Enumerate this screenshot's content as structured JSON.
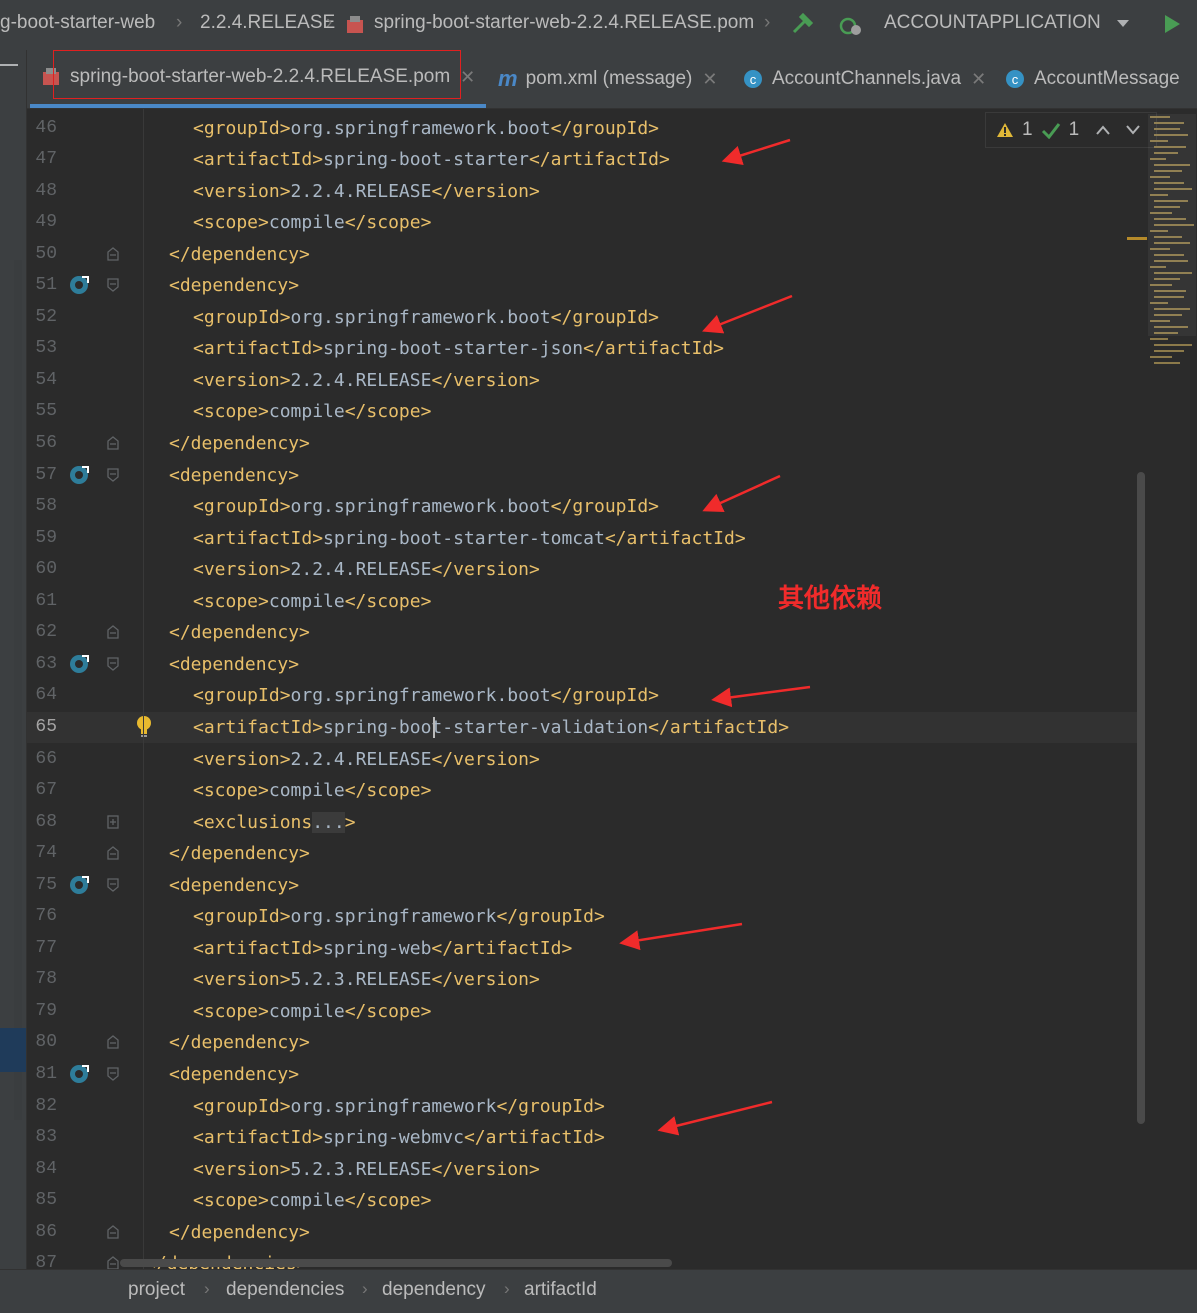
{
  "breadcrumb_nav": {
    "items": [
      "g-boot-starter-web",
      "2.2.4.RELEASE",
      "spring-boot-starter-web-2.2.4.RELEASE.pom"
    ],
    "run_config": "ACCOUNTAPPLICATION"
  },
  "tabs": [
    {
      "label": "spring-boot-starter-web-2.2.4.RELEASE.pom",
      "active": true
    },
    {
      "label": "pom.xml (message)",
      "active": false
    },
    {
      "label": "AccountChannels.java",
      "active": false
    },
    {
      "label": "AccountMessage",
      "active": false
    }
  ],
  "inspection": {
    "warnings": "1",
    "ok": "1"
  },
  "annotation": "其他依赖",
  "code_lines": [
    {
      "n": "46",
      "text": "    <groupId>org.springframework.boot</groupId>"
    },
    {
      "n": "47",
      "text": "    <artifactId>spring-boot-starter</artifactId>"
    },
    {
      "n": "48",
      "text": "    <version>2.2.4.RELEASE</version>"
    },
    {
      "n": "49",
      "text": "    <scope>compile</scope>"
    },
    {
      "n": "50",
      "text": "  </dependency>"
    },
    {
      "n": "51",
      "text": "  <dependency>"
    },
    {
      "n": "52",
      "text": "    <groupId>org.springframework.boot</groupId>"
    },
    {
      "n": "53",
      "text": "    <artifactId>spring-boot-starter-json</artifactId>"
    },
    {
      "n": "54",
      "text": "    <version>2.2.4.RELEASE</version>"
    },
    {
      "n": "55",
      "text": "    <scope>compile</scope>"
    },
    {
      "n": "56",
      "text": "  </dependency>"
    },
    {
      "n": "57",
      "text": "  <dependency>"
    },
    {
      "n": "58",
      "text": "    <groupId>org.springframework.boot</groupId>"
    },
    {
      "n": "59",
      "text": "    <artifactId>spring-boot-starter-tomcat</artifactId>"
    },
    {
      "n": "60",
      "text": "    <version>2.2.4.RELEASE</version>"
    },
    {
      "n": "61",
      "text": "    <scope>compile</scope>"
    },
    {
      "n": "62",
      "text": "  </dependency>"
    },
    {
      "n": "63",
      "text": "  <dependency>"
    },
    {
      "n": "64",
      "text": "    <groupId>org.springframework.boot</groupId>"
    },
    {
      "n": "65",
      "text": "    <artifactId>spring-boot-starter-validation</artifactId>"
    },
    {
      "n": "66",
      "text": "    <version>2.2.4.RELEASE</version>"
    },
    {
      "n": "67",
      "text": "    <scope>compile</scope>"
    },
    {
      "n": "68",
      "text": "    <exclusions...>"
    },
    {
      "n": "74",
      "text": "  </dependency>"
    },
    {
      "n": "75",
      "text": "  <dependency>"
    },
    {
      "n": "76",
      "text": "    <groupId>org.springframework</groupId>"
    },
    {
      "n": "77",
      "text": "    <artifactId>spring-web</artifactId>"
    },
    {
      "n": "78",
      "text": "    <version>5.2.3.RELEASE</version>"
    },
    {
      "n": "79",
      "text": "    <scope>compile</scope>"
    },
    {
      "n": "80",
      "text": "  </dependency>"
    },
    {
      "n": "81",
      "text": "  <dependency>"
    },
    {
      "n": "82",
      "text": "    <groupId>org.springframework</groupId>"
    },
    {
      "n": "83",
      "text": "    <artifactId>spring-webmvc</artifactId>"
    },
    {
      "n": "84",
      "text": "    <version>5.2.3.RELEASE</version>"
    },
    {
      "n": "85",
      "text": "    <scope>compile</scope>"
    },
    {
      "n": "86",
      "text": "  </dependency>"
    },
    {
      "n": "87",
      "text": "</dependencies>"
    }
  ],
  "status_breadcrumbs": [
    "project",
    "dependencies",
    "dependency",
    "artifactId"
  ],
  "colors": {
    "tag": "#e8bf6a",
    "text": "#a9b7c6",
    "annotation": "#f02b2b",
    "background": "#2b2b2b"
  }
}
